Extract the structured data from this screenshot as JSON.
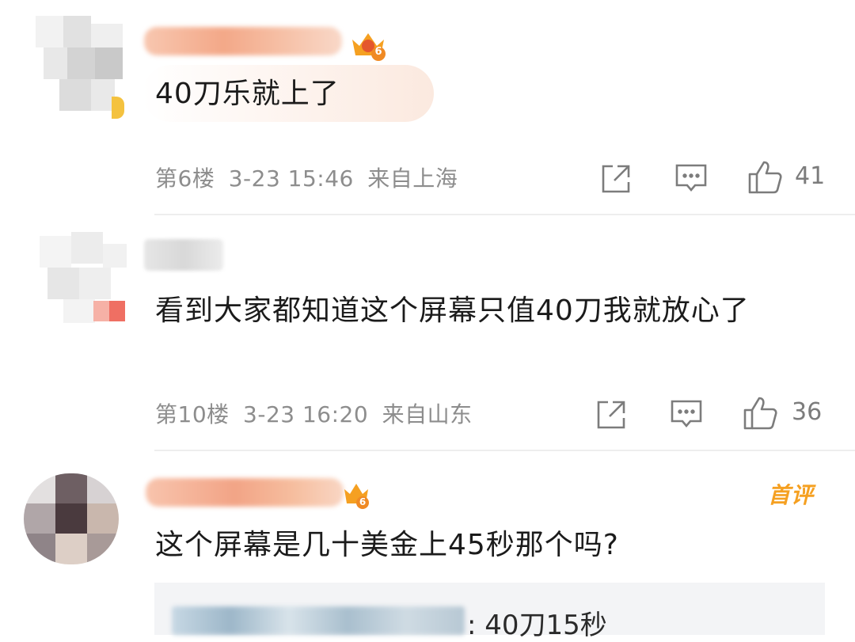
{
  "comments": [
    {
      "text": "40刀乐就上了",
      "floor": "第6楼",
      "time": "3-23 15:46",
      "location": "来自上海",
      "likes": "41"
    },
    {
      "text": "看到大家都知道这个屏幕只值40刀我就放心了",
      "floor": "第10楼",
      "time": "3-23 16:20",
      "location": "来自山东",
      "likes": "36"
    },
    {
      "text": "这个屏幕是几十美金上45秒那个吗?",
      "badge": "首评",
      "reply_text": ": 40刀15秒"
    }
  ],
  "icons": {
    "vip_level": "6",
    "share": "share-icon",
    "comment": "comment-icon",
    "like": "thumbs-up-icon"
  },
  "colors": {
    "badge": "#f5a021",
    "name_blur": "#f6b49a",
    "meta": "#8d8d8d"
  }
}
